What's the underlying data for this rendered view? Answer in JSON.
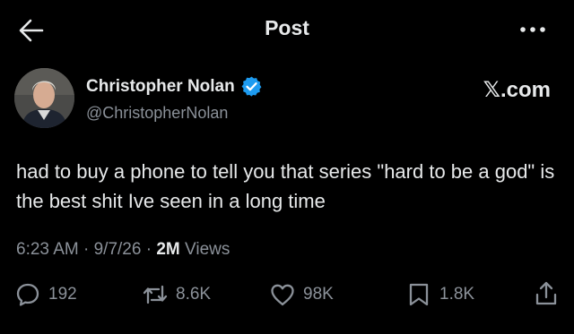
{
  "header": {
    "title": "Post",
    "back_icon": "arrow-left-icon",
    "more_icon": "more-horizontal-icon"
  },
  "post": {
    "author_name": "Christopher Nolan",
    "handle": "@ChristopherNolan",
    "source": ".com",
    "source_logo_letter": "𝕏",
    "verified_color": "#1d9bf0",
    "text": "had to buy a phone to tell you that series \"hard to be a god\" is the best shit Ive seen in a long time",
    "time": "6:23 AM",
    "date": "9/7/26",
    "separator": "·",
    "views_count": "2M",
    "views_label": "Views"
  },
  "actions": {
    "replies": "192",
    "reposts": "8.6K",
    "likes": "98K",
    "bookmarks": "1.8K"
  }
}
